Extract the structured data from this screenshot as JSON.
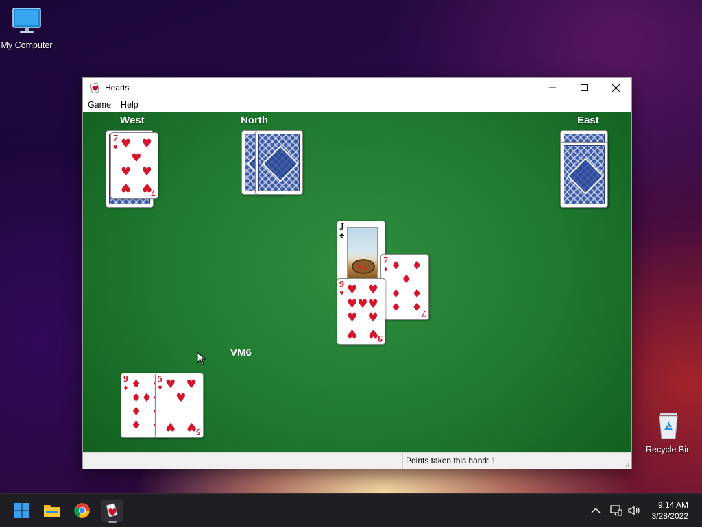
{
  "desktop": {
    "my_computer": "My Computer",
    "recycle_bin": "Recycle Bin"
  },
  "window": {
    "title": "Hearts",
    "menu": [
      "Game",
      "Help"
    ],
    "controls": {
      "minimize": "—",
      "maximize": "☐",
      "close": "✕"
    }
  },
  "game": {
    "players": {
      "west": "West",
      "north": "North",
      "east": "East",
      "south": "VM6"
    },
    "status": "Points taken this hand: 1",
    "west_card": {
      "rank": "7",
      "suit": "♥"
    },
    "trick": [
      {
        "rank": "J",
        "suit": "♣"
      },
      {
        "rank": "7",
        "suit": "♦"
      },
      {
        "rank": "9",
        "suit": "♥"
      }
    ],
    "hand": [
      {
        "rank": "9",
        "suit": "♦"
      },
      {
        "rank": "5",
        "suit": "♥"
      }
    ]
  },
  "taskbar": {
    "time": "9:14 AM",
    "date": "3/28/2022"
  },
  "colors": {
    "felt": "#1f7a30",
    "card_red": "#d3162c",
    "taskbar": "#1f1f23"
  }
}
